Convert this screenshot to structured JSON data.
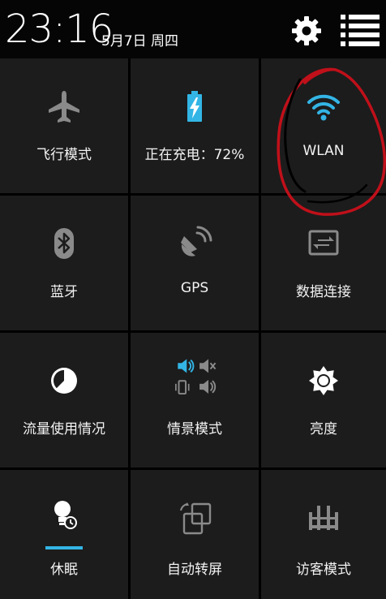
{
  "status": {
    "time": "23:16",
    "date": "5月7日 周四"
  },
  "header": {
    "settings_icon": "gear-icon",
    "list_icon": "list-menu-icon"
  },
  "tiles": [
    {
      "label": "飞行模式",
      "icon": "airplane-icon",
      "active": false
    },
    {
      "label": "正在充电：72%",
      "icon": "battery-charging-icon",
      "active": true,
      "battery_level": 0.72
    },
    {
      "label": "WLAN",
      "icon": "wifi-icon",
      "active": true
    },
    {
      "label": "蓝牙",
      "icon": "bluetooth-icon",
      "active": false
    },
    {
      "label": "GPS",
      "icon": "gps-icon",
      "active": false
    },
    {
      "label": "数据连接",
      "icon": "data-connection-icon",
      "active": false
    },
    {
      "label": "流量使用情况",
      "icon": "data-usage-icon",
      "active": false
    },
    {
      "label": "情景模式",
      "icon": "sound-profile-icon",
      "active": true
    },
    {
      "label": "亮度",
      "icon": "brightness-icon",
      "active": false
    },
    {
      "label": "休眠",
      "icon": "sleep-icon",
      "active": true
    },
    {
      "label": "自动转屏",
      "icon": "auto-rotate-icon",
      "active": false
    },
    {
      "label": "访客模式",
      "icon": "guest-mode-icon",
      "active": false
    }
  ],
  "colors": {
    "accent": "#33b5e5",
    "tile_bg": "#1c1c1c",
    "inactive_icon": "#8a8a8a",
    "annotation": "#c0101a"
  }
}
